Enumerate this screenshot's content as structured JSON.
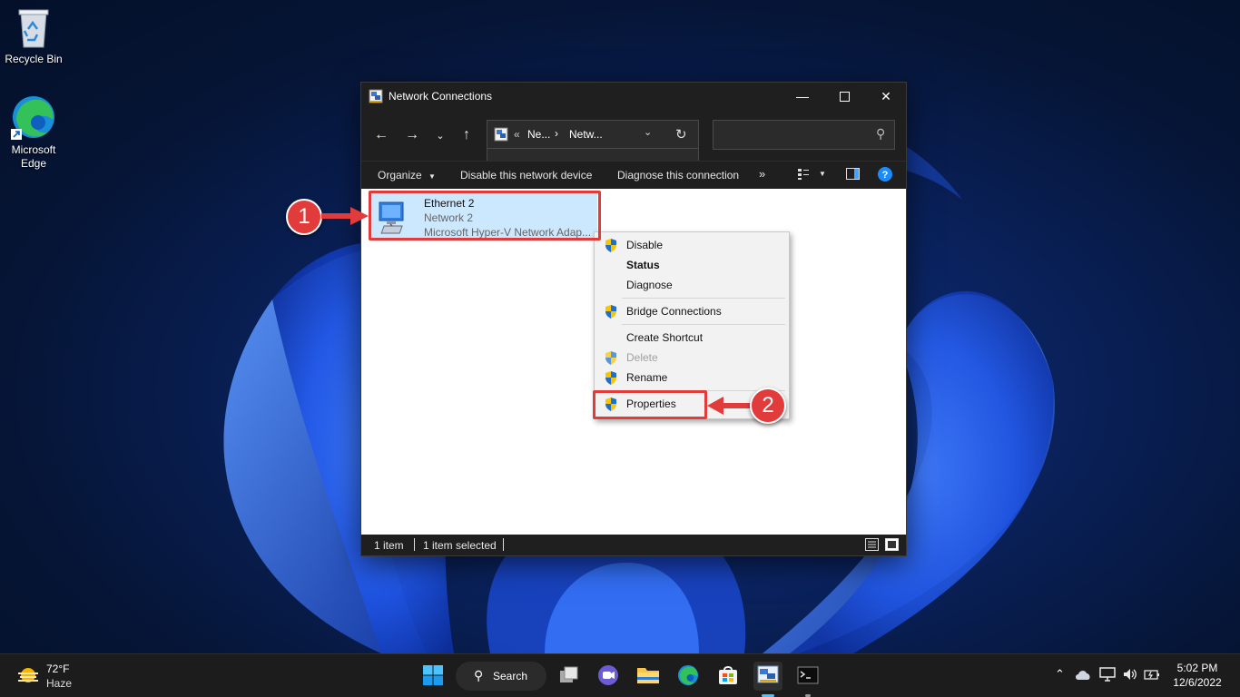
{
  "desktop": {
    "icons": [
      {
        "label": "Recycle Bin"
      },
      {
        "label_line1": "Microsoft",
        "label_line2": "Edge"
      }
    ]
  },
  "window": {
    "title": "Network Connections",
    "breadcrumb": {
      "overflow": "«",
      "seg1": "Ne...",
      "sep": "›",
      "seg2": "Netw..."
    },
    "search_placeholder": "",
    "commands": {
      "organize": "Organize",
      "disable": "Disable this network device",
      "diagnose": "Diagnose this connection",
      "more": "»"
    },
    "item": {
      "name": "Ethernet 2",
      "network": "Network 2",
      "adapter": "Microsoft Hyper-V Network Adap..."
    },
    "status": {
      "count": "1 item",
      "selected": "1 item selected"
    }
  },
  "context_menu": {
    "items": [
      {
        "label": "Disable",
        "shield": true
      },
      {
        "label": "Status",
        "bold": true
      },
      {
        "label": "Diagnose"
      },
      {
        "label": "Bridge Connections",
        "shield": true
      },
      {
        "label": "Create Shortcut"
      },
      {
        "label": "Delete",
        "shield": true,
        "disabled": true
      },
      {
        "label": "Rename",
        "shield": true
      },
      {
        "label": "Properties",
        "shield": true
      }
    ]
  },
  "annotations": {
    "step1": "1",
    "step2": "2"
  },
  "taskbar": {
    "weather": {
      "temp": "72°F",
      "condition": "Haze"
    },
    "search_label": "Search",
    "clock": {
      "time": "5:02 PM",
      "date": "12/6/2022"
    }
  },
  "colors": {
    "annotation": "#e23b3b",
    "selection": "#cce8ff",
    "accent": "#0078d4"
  }
}
